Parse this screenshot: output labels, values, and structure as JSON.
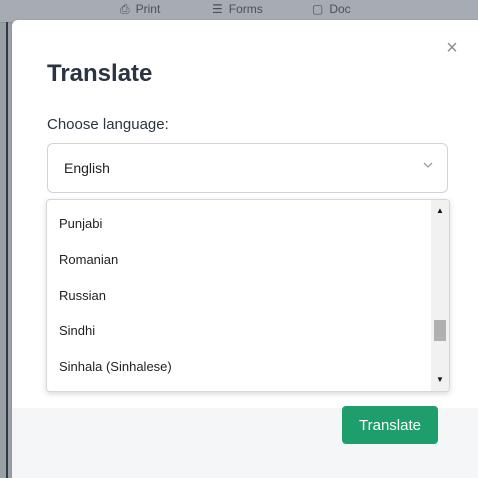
{
  "background_toolbar": {
    "items": [
      {
        "icon": "print-icon",
        "glyph": "⎙",
        "label": "Print"
      },
      {
        "icon": "forms-icon",
        "glyph": "☰",
        "label": "Forms"
      },
      {
        "icon": "doc-icon",
        "glyph": "▢",
        "label": "Doc"
      }
    ]
  },
  "modal": {
    "title": "Translate",
    "close_glyph": "×",
    "language_label": "Choose language:",
    "selected_language": "English",
    "options": [
      "Punjabi",
      "Romanian",
      "Russian",
      "Sindhi",
      "Sinhala (Sinhalese)"
    ],
    "submit_label": "Translate"
  },
  "colors": {
    "primary_button": "#1e9e6a",
    "title_text": "#2b3440"
  }
}
